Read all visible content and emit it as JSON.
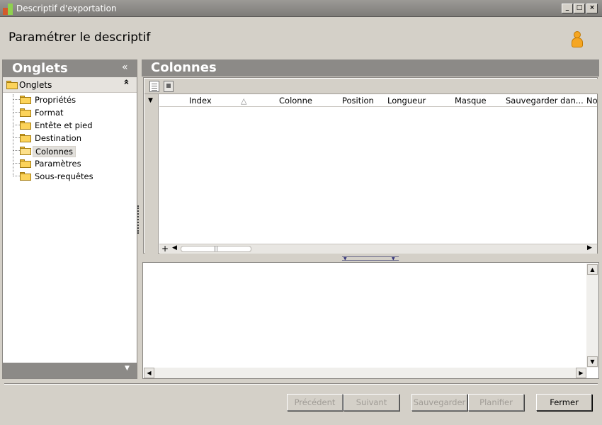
{
  "window": {
    "title": "Descriptif d'exportation"
  },
  "header": {
    "title": "Paramétrer le descriptif"
  },
  "left_panel": {
    "title": "Onglets",
    "collapse_glyph": "«",
    "root": {
      "label": "Onglets",
      "toggle_glyph": "⌃"
    },
    "items": [
      {
        "label": "Propriétés"
      },
      {
        "label": "Format"
      },
      {
        "label": "Entête et pied"
      },
      {
        "label": "Destination"
      },
      {
        "label": "Colonnes",
        "selected": true
      },
      {
        "label": "Paramètres"
      },
      {
        "label": "Sous-requêtes"
      }
    ]
  },
  "right_panel": {
    "title": "Colonnes",
    "grid": {
      "columns": [
        "Index",
        "Colonne",
        "Position",
        "Longueur",
        "Masque",
        "Sauvegarder dan...",
        "No"
      ]
    }
  },
  "buttons": {
    "previous": "Précédent",
    "next": "Suivant",
    "save": "Sauvegarder",
    "schedule": "Planifier",
    "close": "Fermer"
  },
  "icons": {
    "app": "app-icon",
    "user": "user-icon",
    "folder": "folder-icon",
    "new_document": "new-document-icon",
    "edit": "edit-icon"
  }
}
